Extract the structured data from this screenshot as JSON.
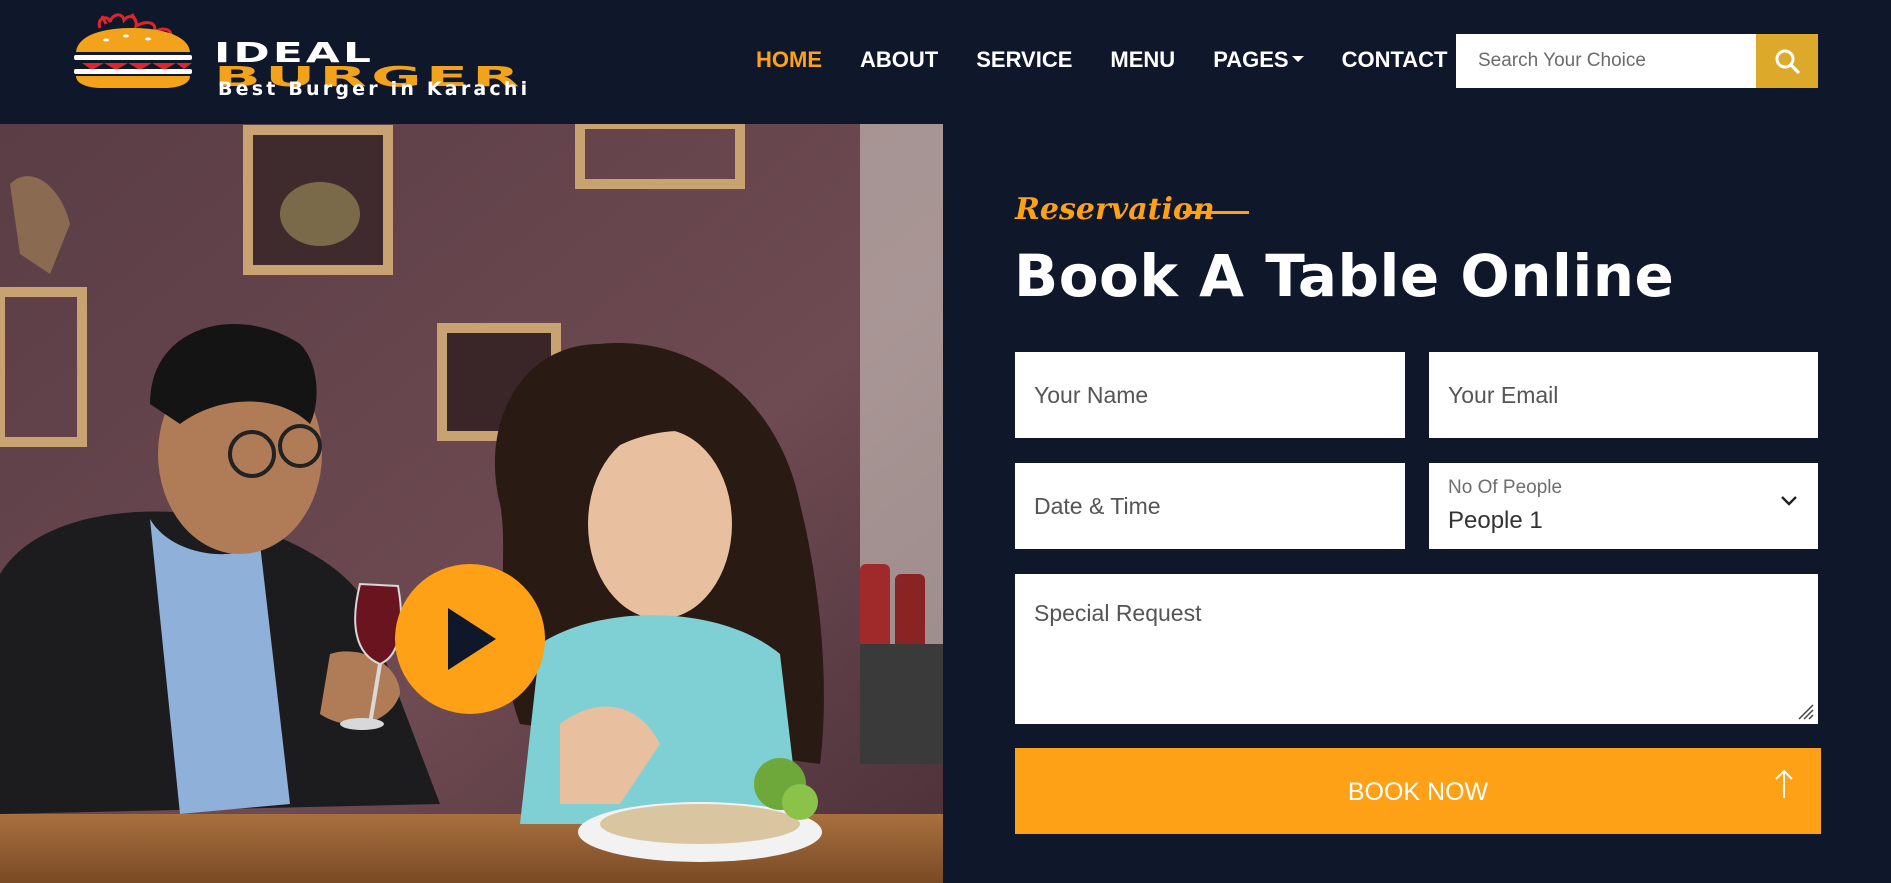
{
  "brand": {
    "name_line1": "IDEAL",
    "name_line2": "BURGER",
    "tagline": "Best Burger in Karachi"
  },
  "nav": {
    "items": [
      {
        "label": "HOME",
        "active": true
      },
      {
        "label": "ABOUT",
        "active": false
      },
      {
        "label": "SERVICE",
        "active": false
      },
      {
        "label": "MENU",
        "active": false
      },
      {
        "label": "PAGES",
        "active": false,
        "dropdown": true
      },
      {
        "label": "CONTACT",
        "active": false
      }
    ],
    "search": {
      "placeholder": "Search Your Choice",
      "icon": "search-icon"
    }
  },
  "media": {
    "play_icon": "play-icon"
  },
  "reservation": {
    "eyebrow": "Reservation",
    "title": "Book A Table Online",
    "fields": {
      "name_placeholder": "Your Name",
      "email_placeholder": "Your Email",
      "datetime_placeholder": "Date & Time",
      "people_label": "No Of People",
      "people_value": "People 1",
      "request_placeholder": "Special Request"
    },
    "submit_label": "BOOK NOW",
    "back_to_top_icon": "arrow-up-icon"
  },
  "colors": {
    "background": "#0f172b",
    "accent": "#fea116",
    "search_button": "#dca92b",
    "text_light": "#ffffff"
  }
}
